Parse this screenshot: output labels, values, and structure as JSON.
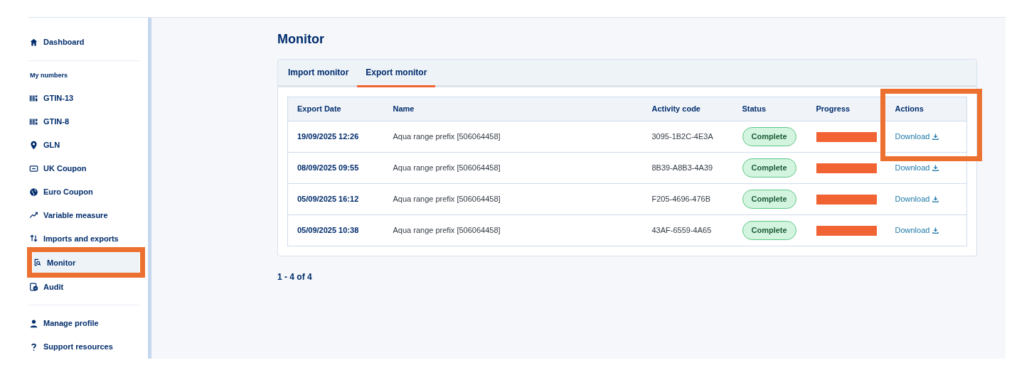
{
  "sidebar": {
    "items": [
      {
        "kind": "link",
        "label": "Dashboard",
        "selected": false,
        "highlighted": false
      },
      {
        "kind": "divider"
      },
      {
        "kind": "heading",
        "label": "My numbers"
      },
      {
        "kind": "link",
        "label": "GTIN-13",
        "selected": false,
        "highlighted": false
      },
      {
        "kind": "link",
        "label": "GTIN-8",
        "selected": false,
        "highlighted": false
      },
      {
        "kind": "link",
        "label": "GLN",
        "selected": false,
        "highlighted": false
      },
      {
        "kind": "link",
        "label": "UK Coupon",
        "selected": false,
        "highlighted": false
      },
      {
        "kind": "link",
        "label": "Euro Coupon",
        "selected": false,
        "highlighted": false
      },
      {
        "kind": "link",
        "label": "Variable measure",
        "selected": false,
        "highlighted": false
      },
      {
        "kind": "link",
        "label": "Imports and exports",
        "selected": false,
        "highlighted": false
      },
      {
        "kind": "link",
        "label": "Monitor",
        "selected": true,
        "highlighted": true
      },
      {
        "kind": "link",
        "label": "Audit",
        "selected": false,
        "highlighted": false
      },
      {
        "kind": "divider"
      },
      {
        "kind": "link",
        "label": "Manage profile",
        "selected": false,
        "highlighted": false
      },
      {
        "kind": "link",
        "label": "Support resources",
        "selected": false,
        "highlighted": false
      }
    ]
  },
  "page_title": "Monitor",
  "tabs": [
    {
      "label": "Import monitor",
      "selected": false
    },
    {
      "label": "Export monitor",
      "selected": true
    }
  ],
  "table": {
    "columns": [
      {
        "label": "Export Date",
        "highlighted": false
      },
      {
        "label": "Name",
        "highlighted": false
      },
      {
        "label": "Activity code",
        "highlighted": false
      },
      {
        "label": "Status",
        "highlighted": false
      },
      {
        "label": "Progress",
        "highlighted": false
      },
      {
        "label": "Actions",
        "highlighted": true
      }
    ],
    "rows": [
      {
        "date": "19/09/2025 12:26",
        "name": "Aqua range prefix [506064458]",
        "activity_code": "3095-1B2C-4E3A",
        "status": "Complete",
        "level": 1,
        "action": "Download"
      },
      {
        "date": "08/09/2025 09:55",
        "name": "Aqua range prefix [506064458]",
        "activity_code": "8B39-A8B3-4A39",
        "status": "Complete",
        "level": 1,
        "action": "Download"
      },
      {
        "date": "05/09/2025 16:12",
        "name": "Aqua range prefix [506064458]",
        "activity_code": "F205-4696-476B",
        "status": "Complete",
        "level": 1,
        "action": "Download"
      },
      {
        "date": "05/09/2025 10:38",
        "name": "Aqua range prefix [506064458]",
        "activity_code": "43AF-6559-4A65",
        "status": "Complete",
        "level": 1,
        "action": "Download"
      }
    ]
  },
  "pagination": "1 - 4 of 4"
}
